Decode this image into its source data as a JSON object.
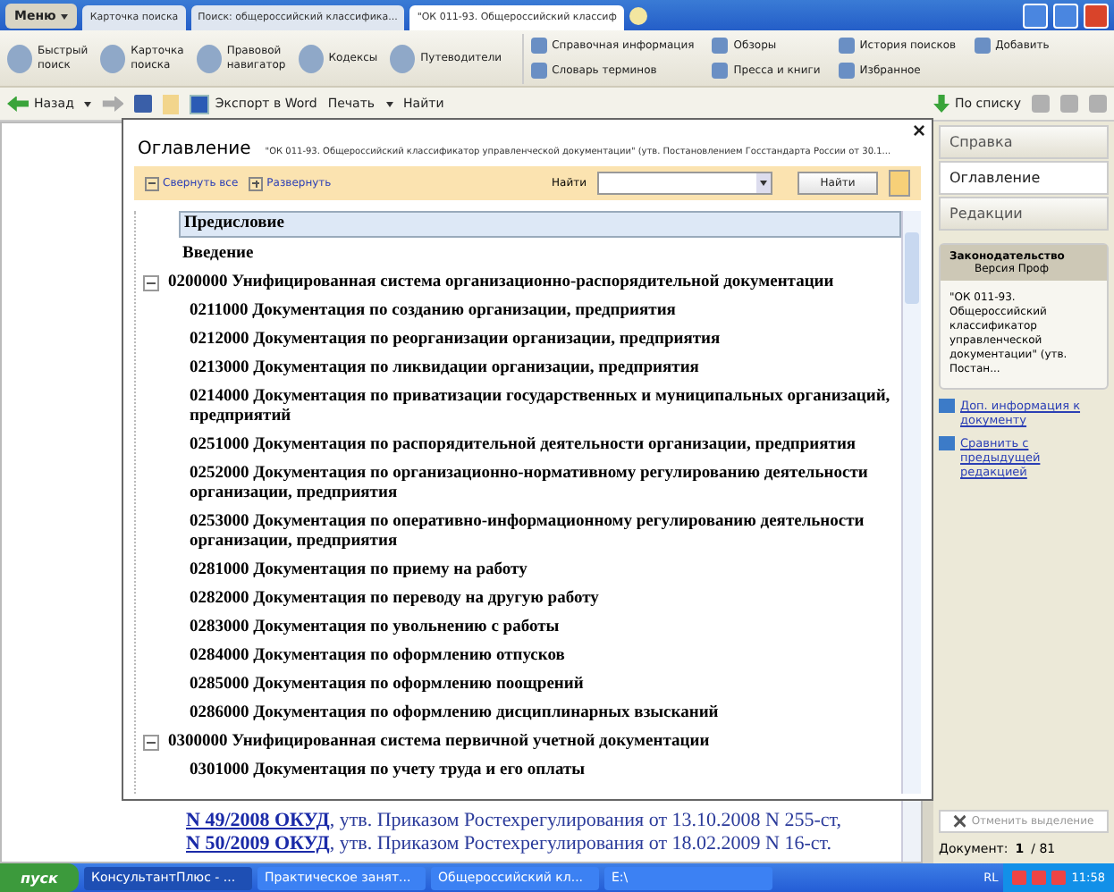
{
  "browser_tabs": [
    {
      "label": "Карточка поиска",
      "selected": false
    },
    {
      "label": "Поиск: общероссийский классифика...",
      "selected": false
    },
    {
      "label": "\"ОК 011-93. Общероссийский классиф",
      "selected": true
    }
  ],
  "menu_button": "Меню",
  "ribbon": [
    {
      "label": "Быстрый поиск"
    },
    {
      "label": "Карточка поиска"
    },
    {
      "label": "Правовой навигатор"
    },
    {
      "label": "Кодексы"
    },
    {
      "label": "Путеводители"
    }
  ],
  "ribbon_small": [
    {
      "label": "Справочная информация"
    },
    {
      "label": "Словарь терминов"
    },
    {
      "label": "Обзоры"
    },
    {
      "label": "Пресса и книги"
    },
    {
      "label": "История поисков"
    },
    {
      "label": "Избранное"
    },
    {
      "label": "Добавить"
    }
  ],
  "toolbar": {
    "back": "Назад",
    "export": "Экспорт в Word",
    "print": "Печать",
    "find": "Найти",
    "by_list": "По списку"
  },
  "dialog": {
    "title": "Оглавление",
    "subtitle": "\"ОК 011-93. Общероссийский классификатор управленческой документации\" (утв. Постановлением Госстандарта России от 30.1...",
    "collapse_all": "Свернуть все",
    "expand": "Развернуть",
    "find_label": "Найти",
    "find_button": "Найти",
    "tree": [
      {
        "label": "Предисловие",
        "selected": true
      },
      {
        "label": "Введение",
        "selected": false
      },
      {
        "label": "0200000 Унифицированная система организационно-распорядительной документации",
        "selected": false,
        "expanded": true,
        "children": [
          {
            "label": "0211000 Документация по созданию организации, предприятия",
            "selected": false
          },
          {
            "label": "0212000 Документация по реорганизации организации, предприятия",
            "selected": false
          },
          {
            "label": "0213000 Документация по ликвидации организации, предприятия",
            "selected": false
          },
          {
            "label": "0214000 Документация по приватизации государственных и муниципальных организаций, предприятий",
            "selected": false
          },
          {
            "label": "0251000 Документация по распорядительной деятельности организации, предприятия",
            "selected": false
          },
          {
            "label": "0252000 Документация по организационно-нормативному регулированию деятельности организации, предприятия",
            "selected": false
          },
          {
            "label": "0253000 Документация по оперативно-информационному регулированию деятельности организации, предприятия",
            "selected": false
          },
          {
            "label": "0281000 Документация по приему на работу",
            "selected": false
          },
          {
            "label": "0282000 Документация по переводу на другую работу",
            "selected": false
          },
          {
            "label": "0283000 Документация по увольнению с работы",
            "selected": false
          },
          {
            "label": "0284000 Документация по оформлению отпусков",
            "selected": false
          },
          {
            "label": "0285000 Документация по оформлению поощрений",
            "selected": false
          },
          {
            "label": "0286000 Документация по оформлению дисциплинарных взысканий",
            "selected": false
          }
        ]
      },
      {
        "label": "0300000 Унифицированная система первичной учетной документации",
        "selected": false,
        "expanded": true,
        "children": [
          {
            "label": "0301000 Документация по учету труда и его оплаты",
            "selected": false
          }
        ]
      }
    ]
  },
  "document_lines": [
    {
      "link": "N 49/2008 ОКУД",
      "text": ", утв. Приказом Ростехрегулирования от 13.10.2008 N 255-ст,"
    },
    {
      "link": "N 50/2009 ОКУД",
      "text": ", утв. Приказом Ростехрегулирования от 18.02.2009 N 16-ст."
    }
  ],
  "side_tabs": [
    {
      "label": "Справка",
      "selected": false
    },
    {
      "label": "Оглавление",
      "selected": true
    },
    {
      "label": "Редакции",
      "selected": false
    }
  ],
  "info_card": {
    "heading": "Законодательство",
    "version": "Версия Проф",
    "text": "\"ОК 011-93. Общероссийский классификатор управленческой документации\" (утв. Постан..."
  },
  "side_links": [
    "Доп. информация к документу",
    "Сравнить с предыдущей редакцией"
  ],
  "clear_selection": {
    "label": "Отменить выделение",
    "disabled": true
  },
  "doc_counter": {
    "label": "Документ:",
    "current": "1",
    "total": "/ 81"
  },
  "taskbar": {
    "start": "пуск",
    "windows": [
      {
        "label": "КонсультантПлюс - ...",
        "selected": true
      },
      {
        "label": "Практическое занят...",
        "selected": false
      },
      {
        "label": "Общероссийский кл...",
        "selected": false
      },
      {
        "label": "E:\\",
        "selected": false
      }
    ],
    "lang": "RL",
    "clock": "11:58"
  }
}
